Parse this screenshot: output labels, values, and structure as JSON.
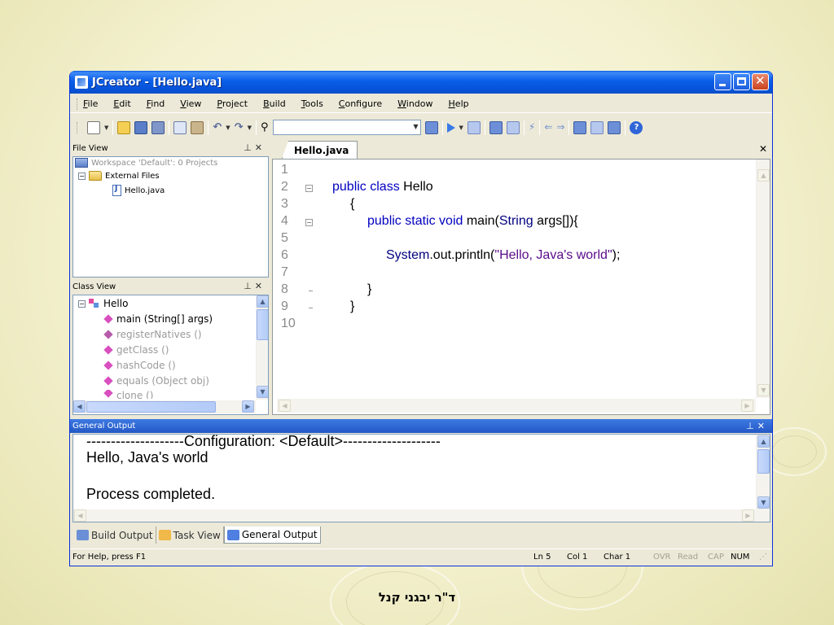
{
  "window": {
    "title": "JCreator - [Hello.java]"
  },
  "menu": [
    "File",
    "Edit",
    "Find",
    "View",
    "Project",
    "Build",
    "Tools",
    "Configure",
    "Window",
    "Help"
  ],
  "file_view": {
    "header": "File View",
    "workspace": "Workspace 'Default': 0 Projects",
    "folder": "External Files",
    "file": "Hello.java"
  },
  "class_view": {
    "header": "Class View",
    "class_name": "Hello",
    "members": [
      "main (String[] args)",
      "registerNatives ()",
      "getClass ()",
      "hashCode ()",
      "equals (Object obj)",
      "clone ()"
    ]
  },
  "editor": {
    "tab": "Hello.java",
    "line_numbers": [
      "1",
      "2",
      "3",
      "4",
      "5",
      "6",
      "7",
      "8",
      "9",
      "10"
    ],
    "code": {
      "l2_kw": "public class",
      "l2_name": " Hello",
      "l3": "{",
      "l4_kw": "public static void",
      "l4_main": " main(",
      "l4_type": "String",
      "l4_rest": " args[]){",
      "l6_sys": "System",
      "l6_call": ".out.println(",
      "l6_str": "\"Hello, Java's world\"",
      "l6_end": ");",
      "l8": "}",
      "l9": "}"
    }
  },
  "output": {
    "header": "General Output",
    "lines": [
      "--------------------Configuration: <Default>--------------------",
      "Hello, Java's world",
      "",
      "Process completed."
    ]
  },
  "bottom_tabs": [
    "Build Output",
    "Task View",
    "General Output"
  ],
  "status": {
    "help": "For Help, press F1",
    "ln": "Ln 5",
    "col": "Col 1",
    "char": "Char 1",
    "ovr": "OVR",
    "read": "Read",
    "cap": "CAP",
    "num": "NUM"
  },
  "caption": "ד\"ר יבגני קנל"
}
